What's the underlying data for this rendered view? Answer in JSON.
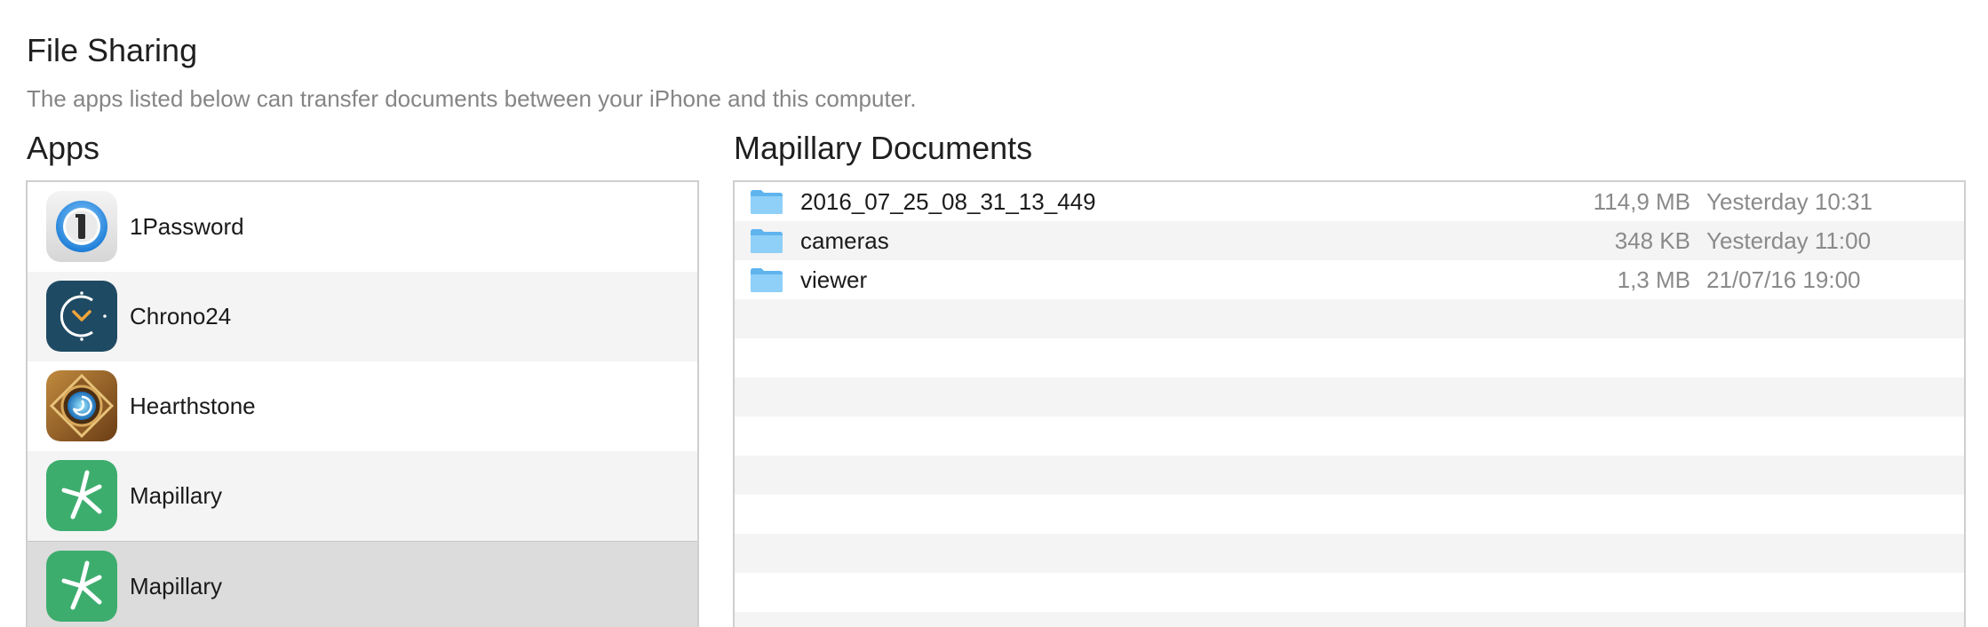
{
  "header": {
    "title": "File Sharing",
    "description": "The apps listed below can transfer documents between your iPhone and this computer."
  },
  "apps": {
    "title": "Apps",
    "items": [
      {
        "name": "1Password",
        "icon": "1password-icon"
      },
      {
        "name": "Chrono24",
        "icon": "chrono24-icon"
      },
      {
        "name": "Hearthstone",
        "icon": "hearthstone-icon"
      },
      {
        "name": "Mapillary",
        "icon": "mapillary-icon"
      },
      {
        "name": "Mapillary",
        "icon": "mapillary-icon",
        "selected": true
      }
    ]
  },
  "documents": {
    "title": "Mapillary Documents",
    "items": [
      {
        "name": "2016_07_25_08_31_13_449",
        "size": "114,9 MB",
        "date": "Yesterday 10:31",
        "icon": "folder-icon"
      },
      {
        "name": "cameras",
        "size": "348 KB",
        "date": "Yesterday 11:00",
        "icon": "folder-icon"
      },
      {
        "name": "viewer",
        "size": "1,3 MB",
        "date": "21/07/16 19:00",
        "icon": "folder-icon"
      }
    ]
  },
  "colors": {
    "folder": "#74c3f3",
    "mapillary": "#3dad6e",
    "chrono24": "#1f4a63",
    "selected_row": "#dcdcdc",
    "alt_row": "#f4f4f4"
  }
}
